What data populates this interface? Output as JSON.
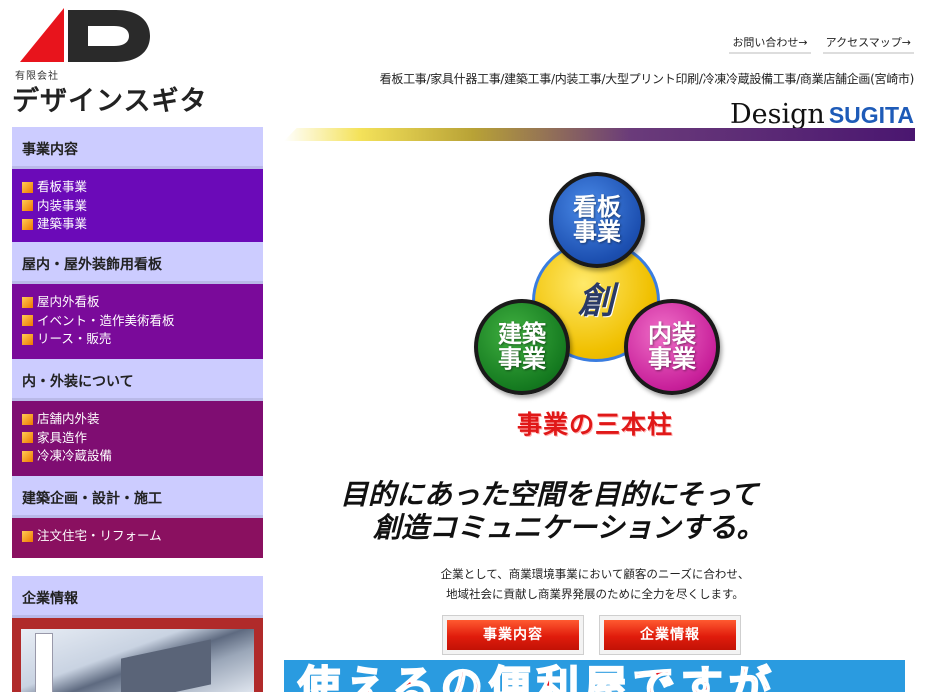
{
  "logo": {
    "company_type": "有限会社",
    "company_name": "デザインスギタ"
  },
  "toplinks": [
    {
      "label": "お問い合わせ→"
    },
    {
      "label": "アクセスマップ→"
    }
  ],
  "services_line": "看板工事/家具什器工事/建築工事/内装工事/大型プリント印刷/冷凍冷蔵設備工事/商業店舗企画(宮崎市)",
  "brand": {
    "design": "Design",
    "sugita": "SUGITA",
    "accent_color": "#1e5bb8"
  },
  "sidebar": {
    "sections": [
      {
        "title": "事業内容",
        "items": [
          "看板事業",
          "内装事業",
          "建築事業"
        ],
        "color": "#6b0ab8"
      },
      {
        "title": "屋内・屋外装飾用看板",
        "items": [
          "屋内外看板",
          "イベント・造作美術看板",
          "リース・販売"
        ],
        "color": "#7a0a9a"
      },
      {
        "title": "内・外装について",
        "items": [
          "店舗内外装",
          "家具造作",
          "冷凍冷蔵設備"
        ],
        "color": "#7f0d72"
      },
      {
        "title": "建築企画・設計・施工",
        "items": [
          "注文住宅・リフォーム"
        ],
        "color": "#8a1060"
      }
    ],
    "corp": {
      "title": "企業情報"
    },
    "header_color": "#ccccff"
  },
  "diagram": {
    "center": "創",
    "top": [
      "看板",
      "事業"
    ],
    "left": [
      "建築",
      "事業"
    ],
    "right": [
      "内装",
      "事業"
    ],
    "caption": "事業の三本柱"
  },
  "tagline": {
    "line1": "目的にあった空間を目的にそって",
    "line2": "創造コミュニケーションする。"
  },
  "description": {
    "line1": "企業として、商業環境事業において顧客のニーズに合わせ、",
    "line2": "地域社会に貢献し商業界発展のために全力を尽くします。"
  },
  "buttons": {
    "business": "事業内容",
    "corporate": "企業情報"
  },
  "banner": {
    "text": "使えるの便利屋ですが"
  }
}
